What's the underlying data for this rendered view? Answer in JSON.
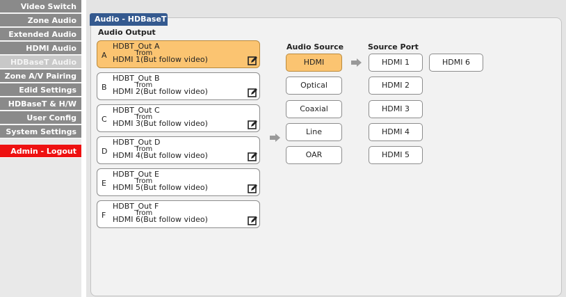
{
  "sidebar": {
    "items": [
      {
        "label": "Video Switch"
      },
      {
        "label": "Zone Audio"
      },
      {
        "label": "Extended Audio"
      },
      {
        "label": "HDMI Audio"
      },
      {
        "label": "HDBaseT Audio"
      },
      {
        "label": "Zone A/V Pairing"
      },
      {
        "label": "Edid Settings"
      },
      {
        "label": "HDBaseT & H/W"
      },
      {
        "label": "User Config"
      },
      {
        "label": "System Settings"
      },
      {
        "label": "Admin - Logout"
      }
    ],
    "active_index": 4
  },
  "panel": {
    "tab_title": "Audio - HDBaseT",
    "output_title": "Audio Output",
    "source_title": "Audio Source",
    "port_title": "Source Port"
  },
  "outputs": [
    {
      "letter": "A",
      "name": "HDBT_Out A",
      "from": "from",
      "source": "HDMI 1(But follow video)",
      "selected": true
    },
    {
      "letter": "B",
      "name": "HDBT_Out B",
      "from": "from",
      "source": "HDMI 2(But follow video)",
      "selected": false
    },
    {
      "letter": "C",
      "name": "HDBT_Out C",
      "from": "from",
      "source": "HDMI 3(But follow video)",
      "selected": false
    },
    {
      "letter": "D",
      "name": "HDBT_Out D",
      "from": "from",
      "source": "HDMI 4(But follow video)",
      "selected": false
    },
    {
      "letter": "E",
      "name": "HDBT_Out E",
      "from": "from",
      "source": "HDMI 5(But follow video)",
      "selected": false
    },
    {
      "letter": "F",
      "name": "HDBT_Out F",
      "from": "from",
      "source": "HDMI 6(But follow video)",
      "selected": false
    }
  ],
  "audio_sources": [
    {
      "label": "HDMI",
      "selected": true
    },
    {
      "label": "Optical",
      "selected": false
    },
    {
      "label": "Coaxial",
      "selected": false
    },
    {
      "label": "Line",
      "selected": false
    },
    {
      "label": "OAR",
      "selected": false
    }
  ],
  "source_ports": [
    "HDMI 1",
    "HDMI 2",
    "HDMI 3",
    "HDMI 4",
    "HDMI 5",
    "HDMI 6"
  ],
  "icons": {
    "edit": "edit-icon",
    "arrow": "arrow-right-icon"
  },
  "colors": {
    "selected": "#fbc471",
    "tab": "#34598f",
    "sidebar": "#8a8a8a",
    "sidebar_active": "#c8c8c8",
    "logout": "#ee1111"
  }
}
